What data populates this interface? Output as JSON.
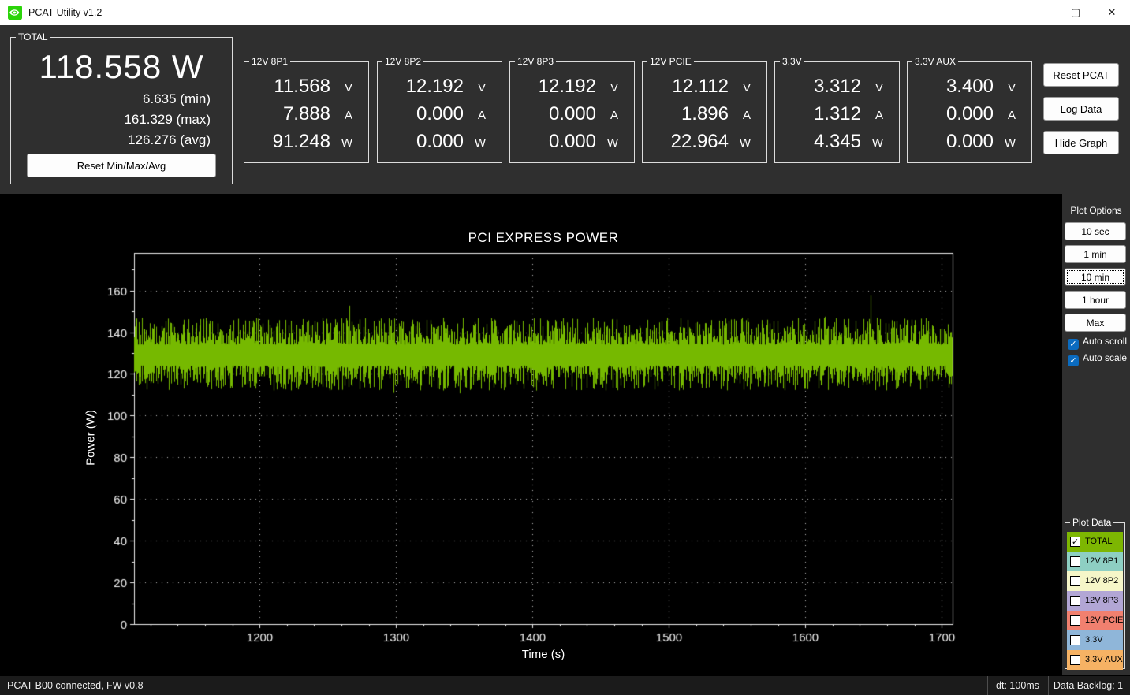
{
  "window": {
    "title": "PCAT Utility v1.2",
    "logo_icon": "nvidia-eye",
    "icons": {
      "minimize": "—",
      "maximize": "▢",
      "close": "✕"
    }
  },
  "total": {
    "label": "TOTAL",
    "value": "118.558 W",
    "min": "6.635 (min)",
    "max": "161.329 (max)",
    "avg": "126.276 (avg)",
    "reset_button": "Reset Min/Max/Avg"
  },
  "units": {
    "voltage": "V",
    "current": "A",
    "power": "W"
  },
  "rails": [
    {
      "label": "12V 8P1",
      "voltage": "11.568",
      "current": "7.888",
      "power": "91.248"
    },
    {
      "label": "12V 8P2",
      "voltage": "12.192",
      "current": "0.000",
      "power": "0.000"
    },
    {
      "label": "12V 8P3",
      "voltage": "12.192",
      "current": "0.000",
      "power": "0.000"
    },
    {
      "label": "12V PCIE",
      "voltage": "12.112",
      "current": "1.896",
      "power": "22.964"
    },
    {
      "label": "3.3V",
      "voltage": "3.312",
      "current": "1.312",
      "power": "4.345"
    },
    {
      "label": "3.3V AUX",
      "voltage": "3.400",
      "current": "0.000",
      "power": "0.000"
    }
  ],
  "actions": {
    "reset_pcat": "Reset PCAT",
    "log_data": "Log Data",
    "hide_graph": "Hide Graph"
  },
  "plot_options": {
    "label": "Plot Options",
    "buttons": [
      {
        "label": "10 sec",
        "selected": false
      },
      {
        "label": "1 min",
        "selected": false
      },
      {
        "label": "10 min",
        "selected": true
      },
      {
        "label": "1 hour",
        "selected": false
      },
      {
        "label": "Max",
        "selected": false
      }
    ],
    "checkboxes": [
      {
        "label": "Auto scroll",
        "checked": true
      },
      {
        "label": "Auto scale",
        "checked": true
      }
    ]
  },
  "plot_data": {
    "label": "Plot Data",
    "series": [
      {
        "label": "TOTAL",
        "color": "#7db602",
        "checked": true
      },
      {
        "label": "12V 8P1",
        "color": "#8ecfc3",
        "checked": false
      },
      {
        "label": "12V 8P2",
        "color": "#f6f6c8",
        "checked": false
      },
      {
        "label": "12V 8P3",
        "color": "#b2a6d5",
        "checked": false
      },
      {
        "label": "12V PCIE",
        "color": "#f1806f",
        "checked": false
      },
      {
        "label": "3.3V",
        "color": "#8fb6d9",
        "checked": false
      },
      {
        "label": "3.3V AUX",
        "color": "#f6b264",
        "checked": false
      }
    ]
  },
  "chart_data": {
    "type": "line",
    "title": "PCI EXPRESS POWER",
    "xlabel": "Time (s)",
    "ylabel": "Power (W)",
    "xlim": [
      1108,
      1708
    ],
    "ylim": [
      0,
      178
    ],
    "x_ticks": [
      1200,
      1300,
      1400,
      1500,
      1600,
      1700
    ],
    "y_ticks": [
      0,
      20,
      40,
      60,
      80,
      100,
      120,
      140,
      160
    ],
    "x_minor_step": 20,
    "y_minor_step": 10,
    "grid": "dotted",
    "background": "#000000",
    "series": [
      {
        "name": "TOTAL",
        "color": "#76b900",
        "style": "noisy-band",
        "band_core": [
          118,
          144
        ],
        "observed_min": 107,
        "observed_max": 158,
        "peak": {
          "t": 1648,
          "value": 157.5
        }
      }
    ]
  },
  "status_bar": {
    "left": "PCAT B00 connected, FW v0.8",
    "dt": "dt: 100ms",
    "backlog": "Data Backlog: 1"
  }
}
